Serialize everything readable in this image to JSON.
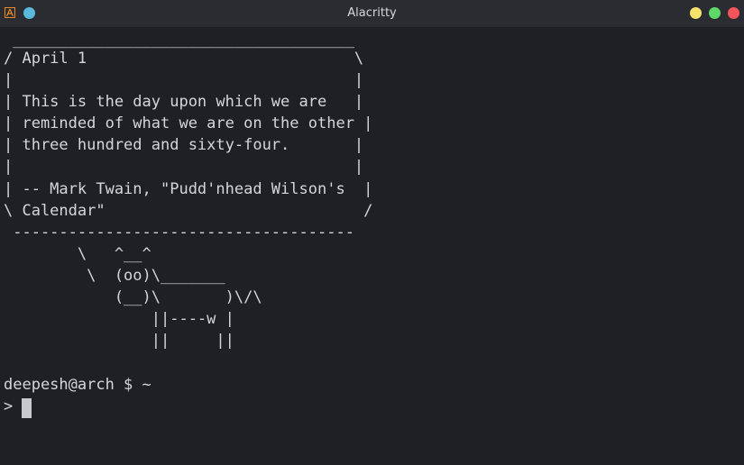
{
  "window": {
    "title": "Alacritty",
    "colors": {
      "background": "#1e2024",
      "titlebar": "#2a2c31",
      "text": "#d4d6d9",
      "minimize": "#f5e36c",
      "maximize": "#5fd86a",
      "close": "#f2545b",
      "pin": "#5ab8dd"
    },
    "icons": [
      "alacritty-app-icon",
      "pin-dot-icon",
      "minimize-icon",
      "maximize-icon",
      "close-icon"
    ]
  },
  "terminal": {
    "lines": [
      " _____________________________________",
      "/ April 1                             \\",
      "|                                     |",
      "| This is the day upon which we are   |",
      "| reminded of what we are on the other |",
      "| three hundred and sixty-four.       |",
      "|                                     |",
      "| -- Mark Twain, \"Pudd'nhead Wilson's  |",
      "\\ Calendar\"                            /",
      " -------------------------------------",
      "        \\   ^__^",
      "         \\  (oo)\\_______",
      "            (__)\\       )\\/\\",
      "                ||----w |",
      "                ||     ||",
      "",
      "deepesh@arch $ ~",
      "> "
    ]
  }
}
